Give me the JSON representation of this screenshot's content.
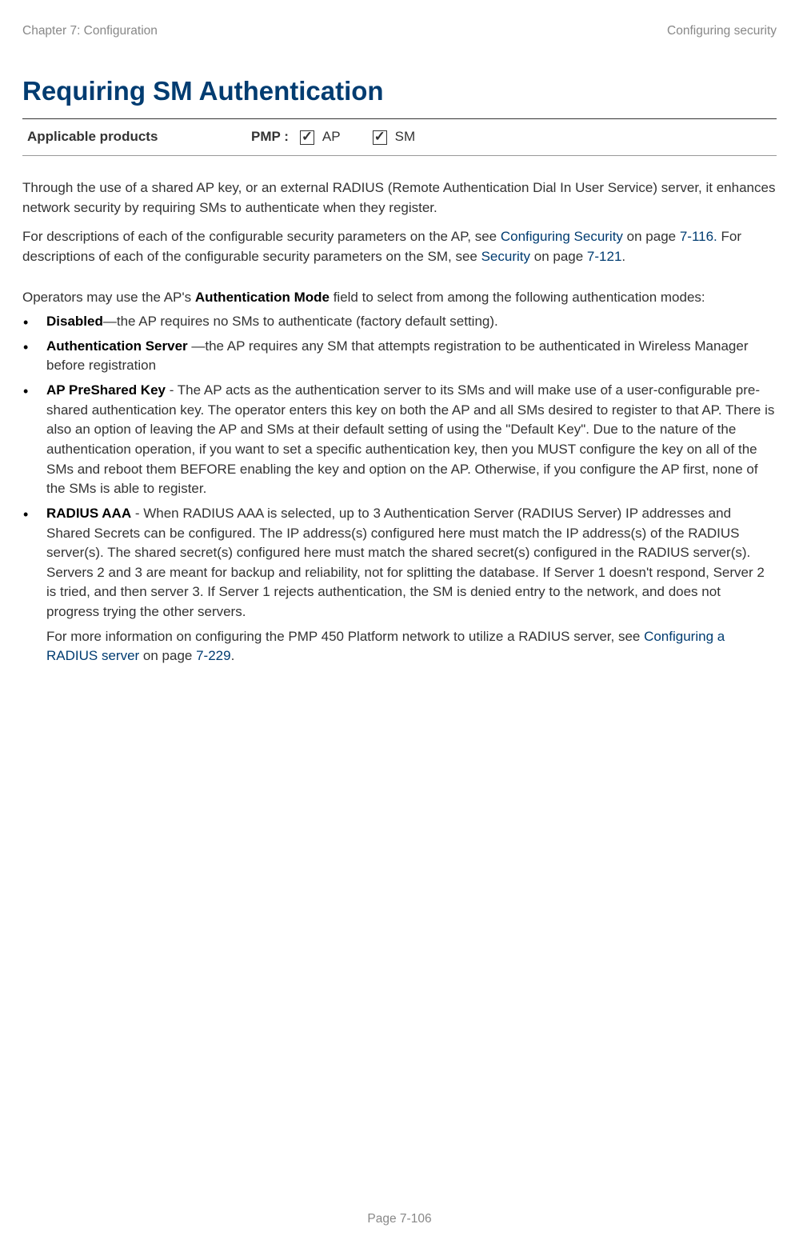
{
  "header": {
    "left": "Chapter 7:  Configuration",
    "right": "Configuring security"
  },
  "title": "Requiring SM Authentication",
  "applicable": {
    "label": "Applicable products",
    "pmp": "PMP :",
    "option1": "AP",
    "option2": "SM"
  },
  "para1": "Through the use of a shared AP key, or an external RADIUS (Remote Authentication Dial In User Service) server, it enhances network security by requiring SMs to authenticate when they register.",
  "para2a": "For descriptions of each of the configurable security parameters on the AP, see ",
  "para2_link1": "Configuring Security",
  "para2b": " on page ",
  "para2_link2": "7-116.",
  "para2c": " For descriptions of each of the configurable security parameters on the SM, see ",
  "para2_link3": "Security ",
  "para2d": " on page ",
  "para2_link4": "7-121",
  "para2e": ".",
  "para3a": "Operators may use the AP's ",
  "para3_bold": "Authentication Mode",
  "para3b": " field to select from among the following authentication modes:",
  "bullets": {
    "b1_bold": "Disabled",
    "b1_text": "—the AP requires no SMs to authenticate (factory default setting).",
    "b2_bold": "Authentication Server ",
    "b2_text": "—the AP requires any SM that attempts registration to be authenticated in Wireless Manager before registration",
    "b3_bold": "AP PreShared Key",
    "b3_text": " - The AP acts as the authentication server to its SMs and will make use of a user-configurable pre-shared authentication key. The operator enters this key on both the AP and all SMs desired to register to that AP. There is also an option of leaving the AP and SMs at their default setting of using the \"Default Key\". Due to the nature of the authentication operation, if you want to set a specific authentication key, then you MUST configure the key on all of the SMs and reboot them BEFORE enabling the key and option on the AP. Otherwise, if you configure the AP first, none of the SMs is able to register.",
    "b4_bold": "RADIUS AAA",
    "b4_text": " - When RADIUS AAA is selected, up to 3 Authentication Server (RADIUS Server) IP addresses and Shared Secrets can be configured. The IP address(s) configured here must match the IP address(s) of the RADIUS server(s). The shared secret(s) configured here must match the shared secret(s) configured in the RADIUS server(s). Servers 2 and 3 are meant for backup and reliability, not for splitting the database. If Server 1 doesn't respond, Server 2 is tried, and then server 3. If Server 1 rejects authentication, the SM is denied entry to the network, and does not progress trying the other servers.",
    "b4_extra_a": "For more information on configuring the PMP 450 Platform network to utilize a RADIUS server, see ",
    "b4_extra_link": "Configuring a RADIUS server",
    "b4_extra_b": " on page ",
    "b4_extra_link2": "7-229",
    "b4_extra_c": "."
  },
  "pagenum": "Page 7-106"
}
